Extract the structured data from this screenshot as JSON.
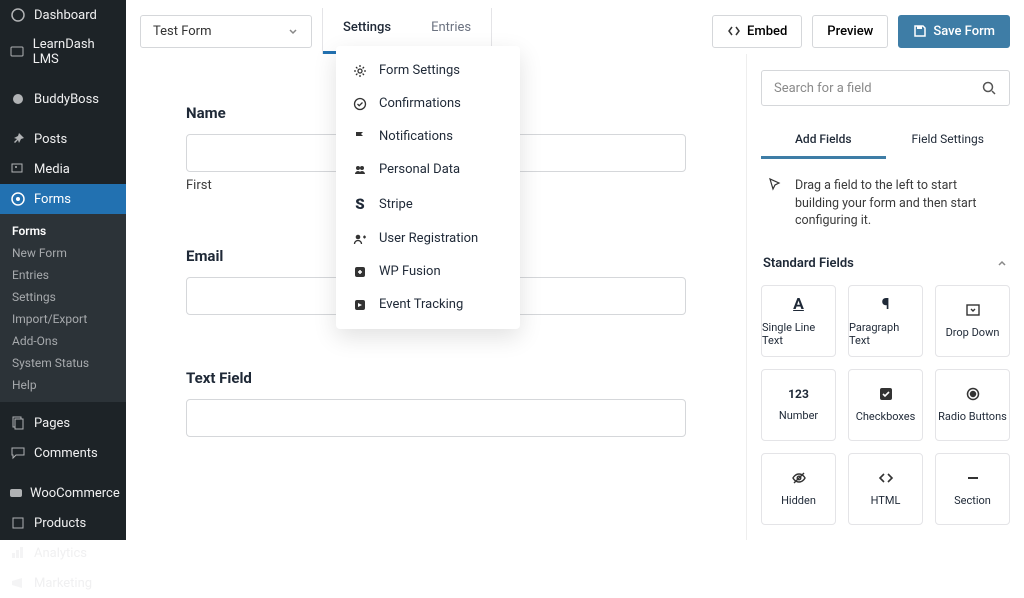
{
  "sidebar": {
    "items": [
      {
        "label": "Dashboard"
      },
      {
        "label": "LearnDash LMS"
      },
      {
        "label": "BuddyBoss"
      },
      {
        "label": "Posts"
      },
      {
        "label": "Media"
      },
      {
        "label": "Forms"
      },
      {
        "label": "Pages"
      },
      {
        "label": "Comments"
      },
      {
        "label": "WooCommerce"
      },
      {
        "label": "Products"
      },
      {
        "label": "Analytics"
      },
      {
        "label": "Marketing"
      }
    ],
    "sub": [
      {
        "label": "Forms"
      },
      {
        "label": "New Form"
      },
      {
        "label": "Entries"
      },
      {
        "label": "Settings"
      },
      {
        "label": "Import/Export"
      },
      {
        "label": "Add-Ons"
      },
      {
        "label": "System Status"
      },
      {
        "label": "Help"
      }
    ]
  },
  "form_select": "Test Form",
  "tabs": {
    "settings": "Settings",
    "entries": "Entries"
  },
  "buttons": {
    "embed": "Embed",
    "preview": "Preview",
    "save": "Save Form"
  },
  "dropdown": [
    {
      "label": "Form Settings"
    },
    {
      "label": "Confirmations"
    },
    {
      "label": "Notifications"
    },
    {
      "label": "Personal Data"
    },
    {
      "label": "Stripe"
    },
    {
      "label": "User Registration"
    },
    {
      "label": "WP Fusion"
    },
    {
      "label": "Event Tracking"
    }
  ],
  "fields": {
    "name": {
      "label": "Name",
      "first": "First"
    },
    "email": {
      "label": "Email"
    },
    "text": {
      "label": "Text Field"
    }
  },
  "panel": {
    "search_placeholder": "Search for a field",
    "tab_add": "Add Fields",
    "tab_settings": "Field Settings",
    "hint": "Drag a field to the left to start building your form and then start configuring it.",
    "section": "Standard Fields",
    "field_buttons": [
      {
        "label": "Single Line Text"
      },
      {
        "label": "Paragraph Text"
      },
      {
        "label": "Drop Down"
      },
      {
        "label": "Number"
      },
      {
        "label": "Checkboxes"
      },
      {
        "label": "Radio Buttons"
      },
      {
        "label": "Hidden"
      },
      {
        "label": "HTML"
      },
      {
        "label": "Section"
      }
    ]
  }
}
